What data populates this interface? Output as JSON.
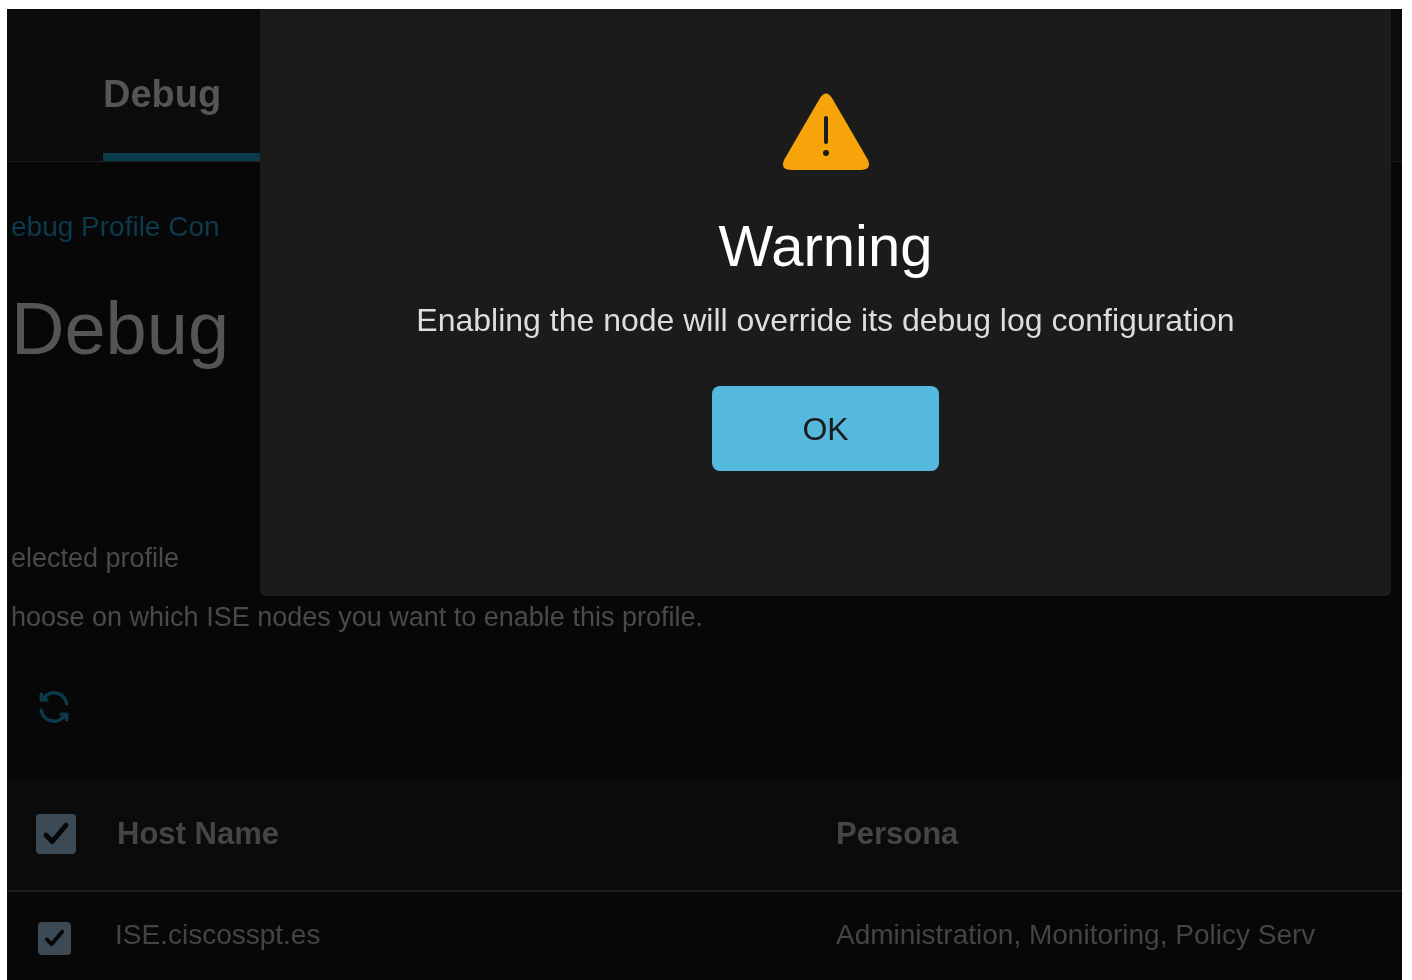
{
  "tabs": [
    {
      "label": "Debug",
      "selected": true
    }
  ],
  "breadcrumb": "ebug Profile Con",
  "page_title": "Debug",
  "selected_profile_label": "elected profile",
  "instructions": "hoose on which ISE nodes you want to enable this profile.",
  "table": {
    "header_checked": true,
    "columns": [
      "Host Name",
      "Persona"
    ],
    "rows": [
      {
        "checked": true,
        "cells": [
          "ISE.ciscosspt.es",
          "Administration, Monitoring, Policy Serv"
        ]
      }
    ]
  },
  "dialog": {
    "title": "Warning",
    "message": "Enabling the node will override its debug log configuration",
    "buttons": [
      "OK"
    ]
  }
}
